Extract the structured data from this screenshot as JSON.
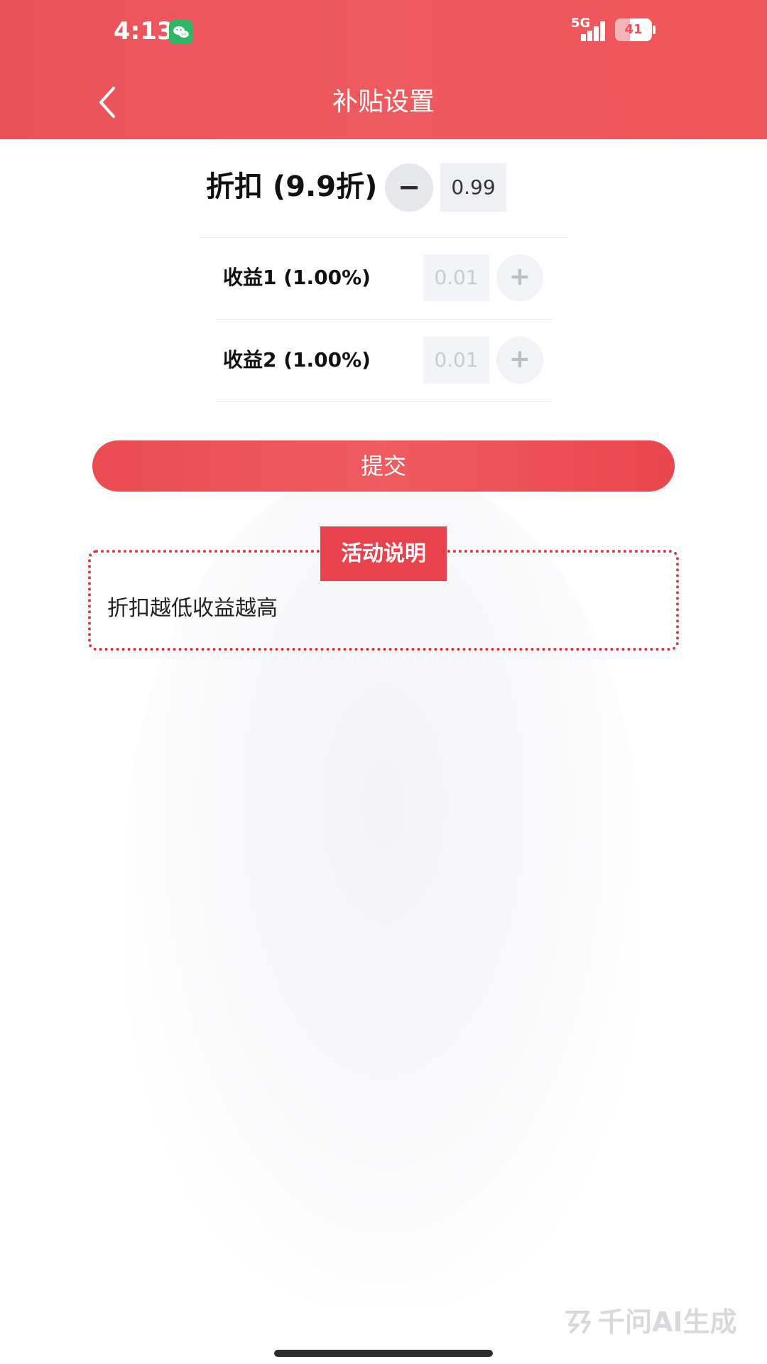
{
  "status_bar": {
    "time": "4:13",
    "network": "5G",
    "battery": "41",
    "battery_level": 0.41
  },
  "header": {
    "title": "补贴设置"
  },
  "discount": {
    "label": "折扣 (9.9折)",
    "decrement_symbol": "−",
    "value": "0.99"
  },
  "earnings": [
    {
      "label": "收益1 (1.00%)",
      "value": "0.01",
      "increment_symbol": "+"
    },
    {
      "label": "收益2 (1.00%)",
      "value": "0.01",
      "increment_symbol": "+"
    }
  ],
  "actions": {
    "submit_label": "提交"
  },
  "notice": {
    "title": "活动说明",
    "text": "折扣越低收益越高"
  },
  "watermark": {
    "text": "千问AI生成"
  },
  "colors": {
    "primary": "#ea525a",
    "button": "#e94c52",
    "notice_border": "#d53a44",
    "wechat": "#2ab865"
  },
  "icons": {
    "back": "chevron-left-icon",
    "wechat": "wechat-icon",
    "signal": "signal-icon",
    "battery": "battery-icon"
  }
}
